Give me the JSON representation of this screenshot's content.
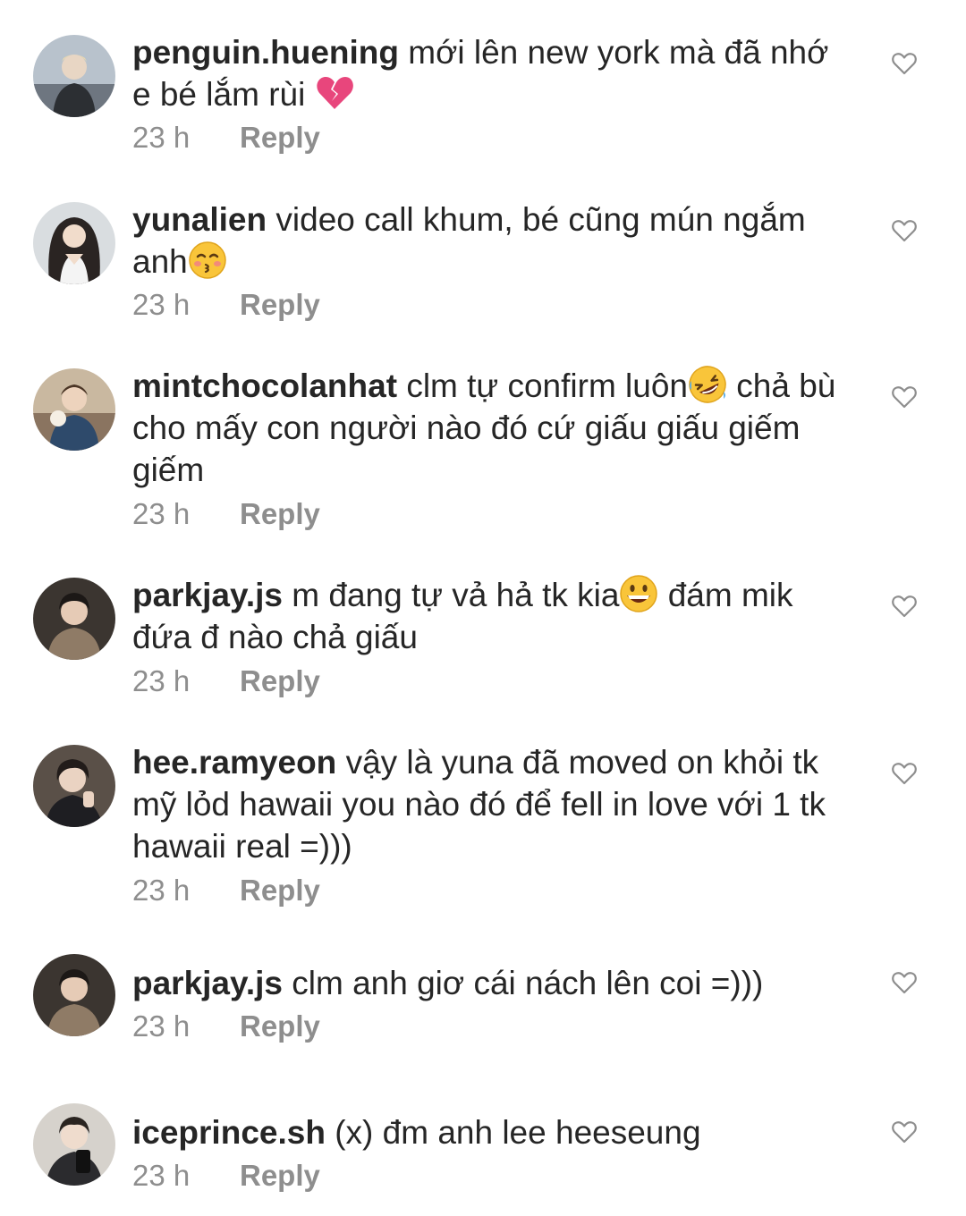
{
  "comments": [
    {
      "username": "penguin.huening",
      "text": "mới lên new york mà đã nhớ e bé lắm rùi",
      "emoji": "broken-heart",
      "time": "23 h",
      "reply": "Reply"
    },
    {
      "username": "yunalien",
      "text": "video call khum, bé cũng mún ngắm anh",
      "emoji": "kissing-face",
      "time": "23 h",
      "reply": "Reply"
    },
    {
      "username": "mintchocolanhat",
      "text_before": "clm tự confirm luôn",
      "emoji": "rolling-laughing-face",
      "text_after": " chả bù cho mấy con người nào đó cứ giấu giấu giếm giếm",
      "time": "23 h",
      "reply": "Reply"
    },
    {
      "username": "parkjay.js",
      "text_before": "m đang tự vả hả tk kia",
      "emoji": "grinning-face",
      "text_after": " đám mik đứa đ nào chả giấu",
      "time": "23 h",
      "reply": "Reply"
    },
    {
      "username": "hee.ramyeon",
      "text": "vậy là yuna đã moved on khỏi tk mỹ lỏd hawaii you nào đó để fell in love với 1 tk hawaii real =)))",
      "time": "23 h",
      "reply": "Reply"
    },
    {
      "username": "parkjay.js",
      "text": "clm anh giơ cái nách lên coi =)))",
      "time": "23 h",
      "reply": "Reply"
    },
    {
      "username": "iceprince.sh",
      "text": "(x) đm anh lee heeseung",
      "time": "23 h",
      "reply": "Reply"
    }
  ],
  "icons": {
    "like": "heart-outline-icon"
  },
  "colors": {
    "text": "#262626",
    "meta": "#8e8e8e",
    "heart_stroke": "#8e8e8e"
  }
}
